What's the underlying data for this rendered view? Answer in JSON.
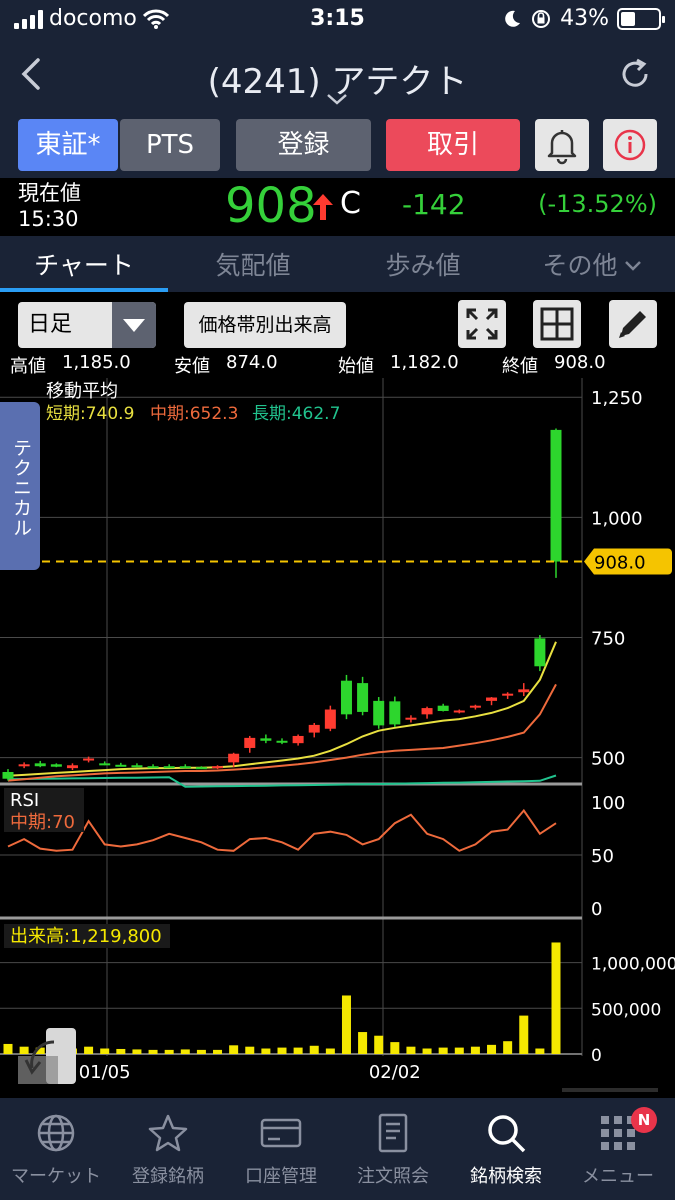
{
  "status_bar": {
    "carrier": "docomo",
    "time": "3:15",
    "battery": "43%"
  },
  "nav": {
    "title": "(4241) アテクト"
  },
  "buttons": {
    "tse": "東証*",
    "pts": "PTS",
    "register": "登録",
    "trade": "取引"
  },
  "price": {
    "label": "現在値",
    "time": "15:30",
    "value": "908",
    "flag": "C",
    "change": "-142",
    "change_pct": "(-13.52%)"
  },
  "tabs": [
    {
      "label": "チャート"
    },
    {
      "label": "気配値"
    },
    {
      "label": "歩み値"
    },
    {
      "label": "その他"
    }
  ],
  "toolbar": {
    "period": "日足",
    "volume_button": "価格帯別出来高"
  },
  "ohlc": {
    "high_label": "高値",
    "high": "1,185.0",
    "low_label": "安値",
    "low": "874.0",
    "open_label": "始値",
    "open": "1,182.0",
    "close_label": "終値",
    "close": "908.0"
  },
  "technical_tab": "テクニカル",
  "chart_data": [
    {
      "type": "candlestick",
      "legend_title": "移動平均",
      "legend": [
        {
          "label": "短期:740.9",
          "color": "#e8e040"
        },
        {
          "label": "中期:652.3",
          "color": "#ee6a3c"
        },
        {
          "label": "長期:462.7",
          "color": "#21c38e"
        }
      ],
      "y_ticks": [
        "1,250",
        "1,000",
        "750",
        "500"
      ],
      "y_tick_values": [
        1250,
        1000,
        750,
        500
      ],
      "ylim": [
        445,
        1290
      ],
      "current_price_label": "908.0",
      "current_price": 908,
      "x_ticks": [
        "01/05",
        "02/02"
      ],
      "x_tick_index": [
        6,
        24
      ],
      "candles": [
        {
          "o": 470,
          "h": 476,
          "l": 452,
          "c": 456
        },
        {
          "o": 485,
          "h": 490,
          "l": 478,
          "c": 486
        },
        {
          "o": 488,
          "h": 493,
          "l": 480,
          "c": 482
        },
        {
          "o": 486,
          "h": 488,
          "l": 480,
          "c": 481
        },
        {
          "o": 478,
          "h": 488,
          "l": 474,
          "c": 484
        },
        {
          "o": 494,
          "h": 502,
          "l": 490,
          "c": 498
        },
        {
          "o": 488,
          "h": 492,
          "l": 484,
          "c": 485
        },
        {
          "o": 485,
          "h": 489,
          "l": 482,
          "c": 482
        },
        {
          "o": 484,
          "h": 488,
          "l": 480,
          "c": 481
        },
        {
          "o": 482,
          "h": 486,
          "l": 478,
          "c": 481
        },
        {
          "o": 482,
          "h": 486,
          "l": 479,
          "c": 480
        },
        {
          "o": 482,
          "h": 486,
          "l": 478,
          "c": 479
        },
        {
          "o": 480,
          "h": 482,
          "l": 476,
          "c": 478
        },
        {
          "o": 478,
          "h": 484,
          "l": 476,
          "c": 482
        },
        {
          "o": 490,
          "h": 510,
          "l": 480,
          "c": 508
        },
        {
          "o": 520,
          "h": 545,
          "l": 510,
          "c": 541
        },
        {
          "o": 540,
          "h": 548,
          "l": 530,
          "c": 535
        },
        {
          "o": 535,
          "h": 540,
          "l": 528,
          "c": 533
        },
        {
          "o": 530,
          "h": 548,
          "l": 525,
          "c": 545
        },
        {
          "o": 552,
          "h": 572,
          "l": 542,
          "c": 568
        },
        {
          "o": 560,
          "h": 608,
          "l": 555,
          "c": 600
        },
        {
          "o": 660,
          "h": 672,
          "l": 580,
          "c": 590
        },
        {
          "o": 655,
          "h": 668,
          "l": 588,
          "c": 595
        },
        {
          "o": 618,
          "h": 626,
          "l": 560,
          "c": 567
        },
        {
          "o": 617,
          "h": 627,
          "l": 564,
          "c": 569
        },
        {
          "o": 582,
          "h": 588,
          "l": 573,
          "c": 583
        },
        {
          "o": 590,
          "h": 606,
          "l": 581,
          "c": 603
        },
        {
          "o": 608,
          "h": 612,
          "l": 596,
          "c": 597
        },
        {
          "o": 598,
          "h": 600,
          "l": 592,
          "c": 598
        },
        {
          "o": 605,
          "h": 610,
          "l": 600,
          "c": 608
        },
        {
          "o": 618,
          "h": 626,
          "l": 609,
          "c": 625
        },
        {
          "o": 630,
          "h": 636,
          "l": 622,
          "c": 633
        },
        {
          "o": 636,
          "h": 655,
          "l": 628,
          "c": 642
        },
        {
          "o": 748,
          "h": 755,
          "l": 680,
          "c": 690
        },
        {
          "o": 1182,
          "h": 1185,
          "l": 874,
          "c": 908
        }
      ],
      "ma_short": [
        462,
        464,
        466,
        468,
        470,
        472,
        474,
        476,
        477,
        478,
        478,
        479,
        479,
        480,
        482,
        486,
        490,
        494,
        498,
        504,
        514,
        528,
        544,
        556,
        562,
        567,
        572,
        577,
        580,
        586,
        593,
        603,
        618,
        662,
        740.9
      ],
      "ma_mid": [
        452,
        455,
        458,
        461,
        463,
        465,
        467,
        468,
        469,
        470,
        471,
        472,
        472,
        473,
        475,
        477,
        480,
        483,
        486,
        490,
        495,
        500,
        506,
        511,
        514,
        516,
        518,
        520,
        525,
        530,
        536,
        543,
        552,
        590,
        652.3
      ],
      "ma_long": [
        455,
        455.4,
        455.8,
        456.2,
        456.6,
        457,
        457.4,
        457.8,
        458.2,
        458.6,
        459,
        439.4,
        439.8,
        440.2,
        440.6,
        441,
        441.5,
        442,
        442.5,
        443,
        443.5,
        444,
        444.5,
        445,
        445.6,
        446.2,
        446.8,
        447.4,
        448,
        448.7,
        449.4,
        450.1,
        450.8,
        451.6,
        462.7
      ]
    },
    {
      "type": "line",
      "title": "RSI",
      "series_name": "中期:70",
      "y_ticks": [
        "100",
        "50",
        "0"
      ],
      "y_tick_values": [
        100,
        50,
        0
      ],
      "ylim": [
        0,
        100
      ],
      "values": [
        58,
        65,
        56,
        54,
        55,
        82,
        60,
        58,
        60,
        64,
        70,
        66,
        62,
        55,
        54,
        65,
        66,
        62,
        55,
        70,
        72,
        69,
        60,
        65,
        80,
        88,
        70,
        65,
        54,
        60,
        72,
        74,
        92,
        70,
        80
      ]
    },
    {
      "type": "bar",
      "title": "出来高:1,219,800",
      "y_ticks": [
        "1,000,000",
        "500,000",
        "0"
      ],
      "y_tick_values": [
        1000000,
        500000,
        0
      ],
      "ylim": [
        0,
        1400000
      ],
      "values": [
        110000,
        80000,
        70000,
        60000,
        60000,
        80000,
        60000,
        55000,
        50000,
        45000,
        45000,
        50000,
        45000,
        45000,
        95000,
        80000,
        60000,
        70000,
        70000,
        90000,
        60000,
        640000,
        240000,
        200000,
        130000,
        80000,
        60000,
        70000,
        70000,
        80000,
        100000,
        140000,
        420000,
        60000,
        1219800
      ]
    }
  ],
  "bottom_tabs": [
    {
      "label": "マーケット"
    },
    {
      "label": "登録銘柄"
    },
    {
      "label": "口座管理"
    },
    {
      "label": "注文照会"
    },
    {
      "label": "銘柄検索"
    },
    {
      "label": "メニュー"
    }
  ],
  "menu_badge": "N",
  "colors": {
    "up": "#ff3b30",
    "down": "#2dd62d",
    "accent_blue": "#5a86f5",
    "trade_red": "#ec4a5b",
    "price_green": "#35d03a",
    "price_tag": "#f5c400"
  }
}
